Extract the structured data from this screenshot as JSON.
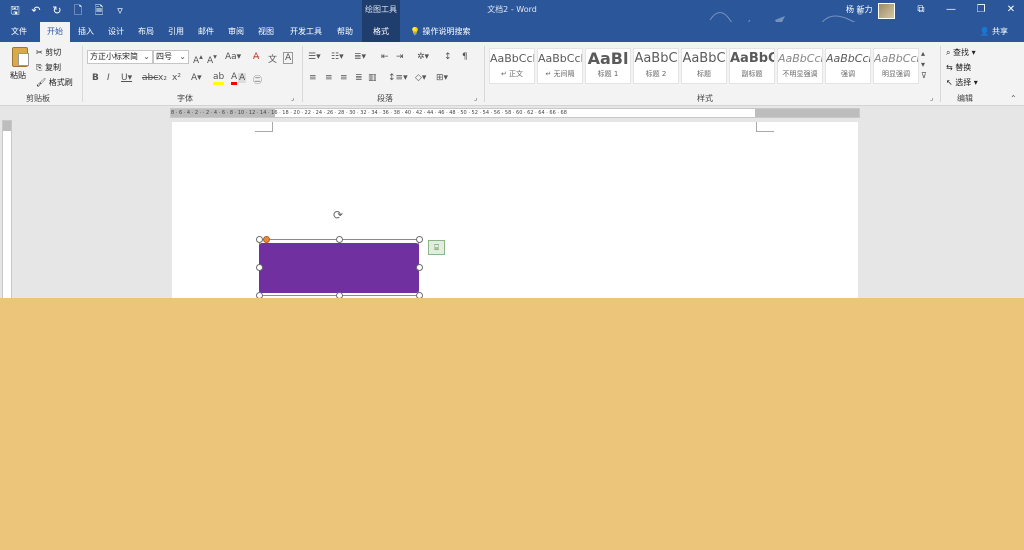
{
  "titlebar": {
    "quick_access": [
      "💾",
      "↶",
      "↻",
      "🗋",
      "🗎",
      "▿"
    ],
    "contextual_header": "绘图工具",
    "document_title": "文档2 - Word",
    "username": "杨 新力",
    "window_controls": [
      "🗖",
      "—",
      "❐",
      "✕"
    ]
  },
  "tabs": {
    "file": "文件",
    "home": "开始",
    "insert": "插入",
    "design": "设计",
    "layout": "布局",
    "references": "引用",
    "mailings": "邮件",
    "review": "审阅",
    "view": "视图",
    "developer": "开发工具",
    "help": "帮助",
    "format": "格式",
    "tell_me": "操作说明搜索",
    "share": "共享"
  },
  "ribbon": {
    "clipboard": {
      "paste": "粘贴",
      "cut": "剪切",
      "copy": "复制",
      "format_painter": "格式刷",
      "label": "剪贴板"
    },
    "font": {
      "font_name": "方正小标宋简",
      "font_size": "四号",
      "label": "字体"
    },
    "paragraph": {
      "label": "段落"
    },
    "styles": {
      "label": "样式",
      "items": [
        {
          "preview": "AaBbCcDd",
          "name": "↵ 正文"
        },
        {
          "preview": "AaBbCcDd",
          "name": "↵ 无间隔"
        },
        {
          "preview": "AaBl",
          "name": "标题 1"
        },
        {
          "preview": "AaBbC",
          "name": "标题 2"
        },
        {
          "preview": "AaBbC",
          "name": "标题"
        },
        {
          "preview": "AaBbC",
          "name": "副标题"
        },
        {
          "preview": "AaBbCcDd",
          "name": "不明显强调"
        },
        {
          "preview": "AaBbCcDd",
          "name": "强调"
        },
        {
          "preview": "AaBbCcDd",
          "name": "明显强调"
        }
      ]
    },
    "editing": {
      "find": "查找",
      "replace": "替换",
      "select": "选择",
      "label": "编辑"
    }
  },
  "ruler": {
    "ticks": "8 · 6 · 4 · 2 · · 2 · 4 · 6 · 8 · 10 · 12 · 14 · 16 · 18 · 20 · 22 · 24 · 26 · 28 · 30 · 32 · 34 · 36 · 38 · 40 · 42 · 44 · 46 · 48 · 50 · 52 · 54 · 56 · 58 · 60 · 62 · 64 · 66 · 68"
  },
  "shape": {
    "fill_color": "#7030a0"
  },
  "colors": {
    "title_blue": "#2b579a",
    "format_tab_dark": "#1f3e6e",
    "overlay": "#ecc47a"
  }
}
